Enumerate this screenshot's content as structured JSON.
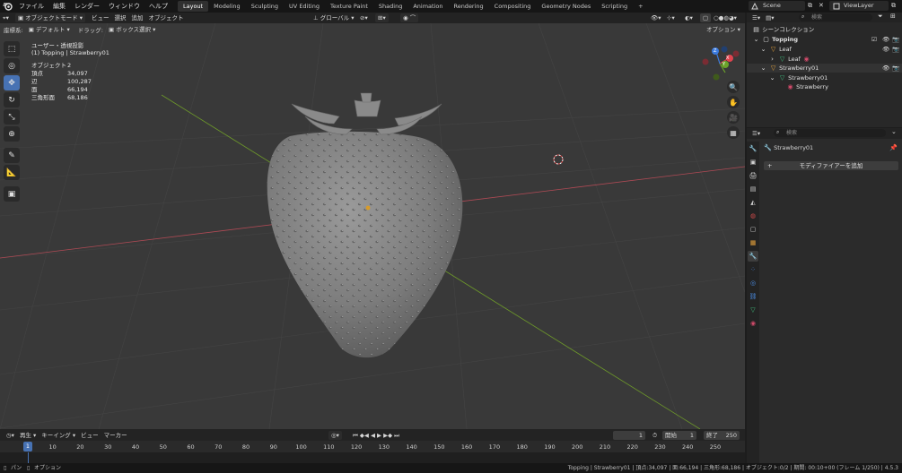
{
  "menubar": {
    "menus": [
      "ファイル",
      "編集",
      "レンダー",
      "ウィンドウ",
      "ヘルプ"
    ],
    "workspaces": [
      "Layout",
      "Modeling",
      "Sculpting",
      "UV Editing",
      "Texture Paint",
      "Shading",
      "Animation",
      "Rendering",
      "Compositing",
      "Geometry Nodes",
      "Scripting"
    ],
    "add_workspace": "+",
    "scene": "Scene",
    "view_layer": "ViewLayer"
  },
  "viewport_header": {
    "mode": "オブジェクトモード",
    "menus": [
      "ビュー",
      "選択",
      "追加",
      "オブジェクト"
    ],
    "orientation": "グローバル",
    "options": "オプション"
  },
  "viewport_subheader": {
    "coord_label": "座標系:",
    "coord_value": "デフォルト",
    "drag_label": "ドラッグ:",
    "drag_value": "ボックス選択"
  },
  "viewport_overlay": {
    "view_name": "ユーザー・透視投影",
    "active": "(1) Topping | Strawberry01",
    "stats": [
      {
        "label": "オブジェクト",
        "value": "2"
      },
      {
        "label": "頂点",
        "value": "34,097"
      },
      {
        "label": "辺",
        "value": "100,287"
      },
      {
        "label": "面",
        "value": "66,194"
      },
      {
        "label": "三角形面",
        "value": "68,186"
      }
    ]
  },
  "gizmo": {
    "x": "X",
    "y": "Y",
    "z": "Z"
  },
  "timeline": {
    "menus": [
      "再生",
      "キーイング",
      "ビュー",
      "マーカー"
    ],
    "current_frame": "1",
    "start_label": "開始",
    "start_value": "1",
    "end_label": "終了",
    "end_value": "250",
    "ticks": [
      "1",
      "10",
      "20",
      "30",
      "40",
      "50",
      "60",
      "70",
      "80",
      "90",
      "100",
      "110",
      "120",
      "130",
      "140",
      "150",
      "160",
      "170",
      "180",
      "190",
      "200",
      "210",
      "220",
      "230",
      "240",
      "250"
    ]
  },
  "statusbar": {
    "left_action_1": "パン",
    "left_action_2": "オプション",
    "info": "Topping | Strawberry01 | 頂点:34,097 | 面:66,194 | 三角形:68,186 | オブジェクト:0/2 | 期間: 00:10+00 (フレーム 1/250) | 4.5.3"
  },
  "outliner": {
    "search_placeholder": "検索",
    "root": "シーンコレクション",
    "items": [
      {
        "label": "Topping"
      },
      {
        "label": "Leaf"
      },
      {
        "label": "Leaf"
      },
      {
        "label": "Strawberry01"
      },
      {
        "label": "Strawberry01"
      },
      {
        "label": "Strawberry"
      }
    ]
  },
  "properties": {
    "search_placeholder": "検索",
    "object_name": "Strawberry01",
    "add_modifier": "モディファイアーを追加"
  },
  "colors": {
    "accent": "#4772b3",
    "x_axis": "#e0444f",
    "y_axis": "#6ba32a",
    "z_axis": "#3b7be0",
    "viewport_bg": "#393939"
  }
}
